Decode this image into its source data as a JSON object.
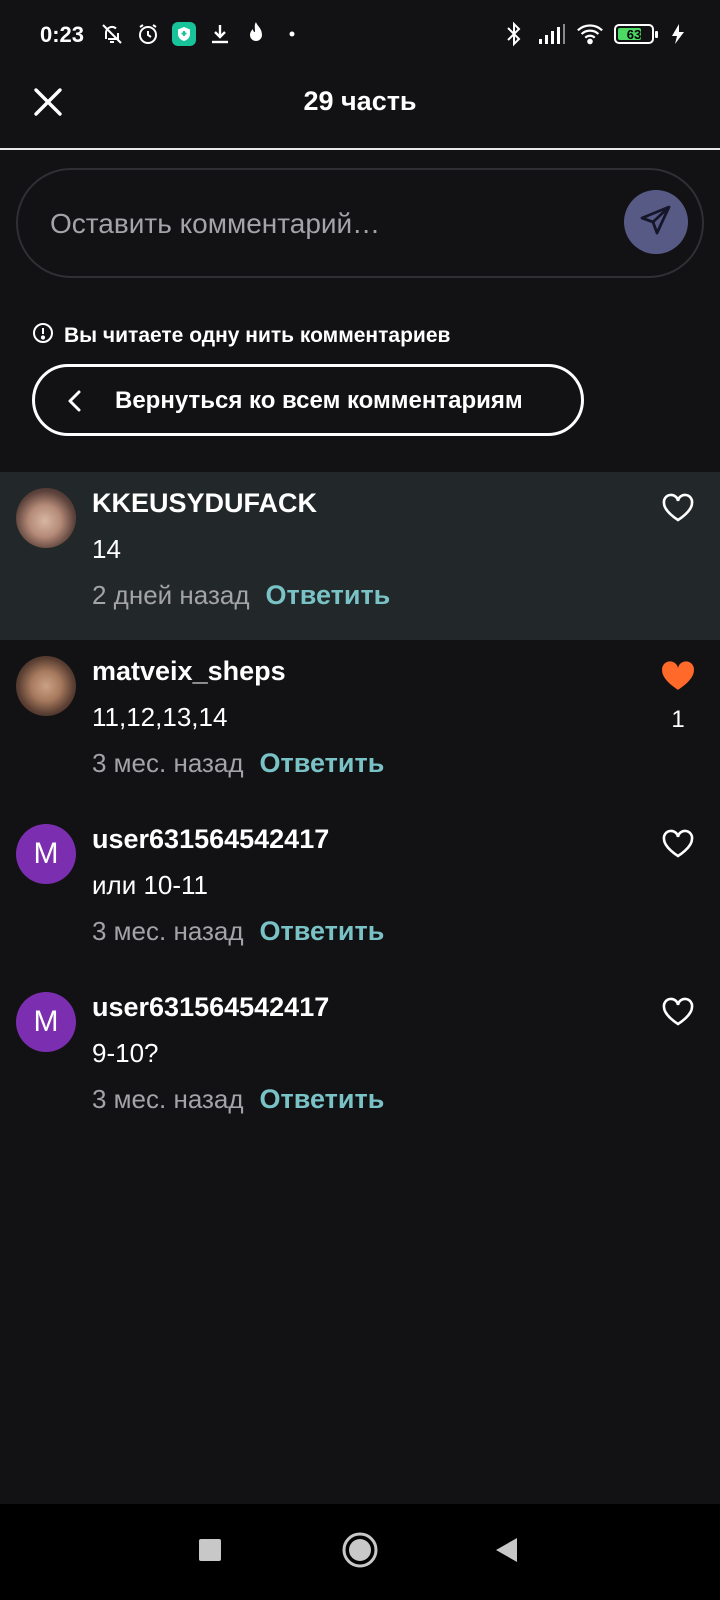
{
  "status_bar": {
    "time": "0:23",
    "battery_level": "63",
    "icons_left": [
      "mute-bell-icon",
      "alarm-icon",
      "shield-app-icon",
      "download-icon",
      "fire-icon",
      "dot-icon"
    ],
    "icons_right": [
      "bluetooth-icon",
      "signal-icon",
      "wifi-icon",
      "battery-icon",
      "charging-icon"
    ]
  },
  "header": {
    "title": "29 часть",
    "close_icon": "close-icon"
  },
  "comment_box": {
    "placeholder": "Оставить комментарий…",
    "send_icon": "send-icon"
  },
  "thread": {
    "notice": "Вы читаете одну нить комментариев",
    "back_label": "Вернуться ко всем комментариям"
  },
  "comments": [
    {
      "username": "KKEUSYDUFACK",
      "text": "14",
      "time": "2 дней назад",
      "reply": "Ответить",
      "liked": false,
      "like_count": "",
      "avatar_letter": ""
    },
    {
      "username": "matveix_sheps",
      "text": "11,12,13,14",
      "time": "3 мес. назад",
      "reply": "Ответить",
      "liked": true,
      "like_count": "1",
      "avatar_letter": ""
    },
    {
      "username": "user631564542417",
      "text": "или 10-11",
      "time": "3 мес. назад",
      "reply": "Ответить",
      "liked": false,
      "like_count": "",
      "avatar_letter": "M"
    },
    {
      "username": "user631564542417",
      "text": "9-10?",
      "time": "3 мес. назад",
      "reply": "Ответить",
      "liked": false,
      "like_count": "",
      "avatar_letter": "M"
    }
  ],
  "colors": {
    "background": "#121214",
    "highlight": "#222829",
    "reply": "#79c2c6",
    "like_active": "#ff6a2b",
    "send_button": "#585a86",
    "avatar_letter_bg": "#7b2fb0"
  },
  "nav_bar": {
    "buttons": [
      "recents-square-icon",
      "home-circle-icon",
      "back-triangle-icon"
    ]
  }
}
